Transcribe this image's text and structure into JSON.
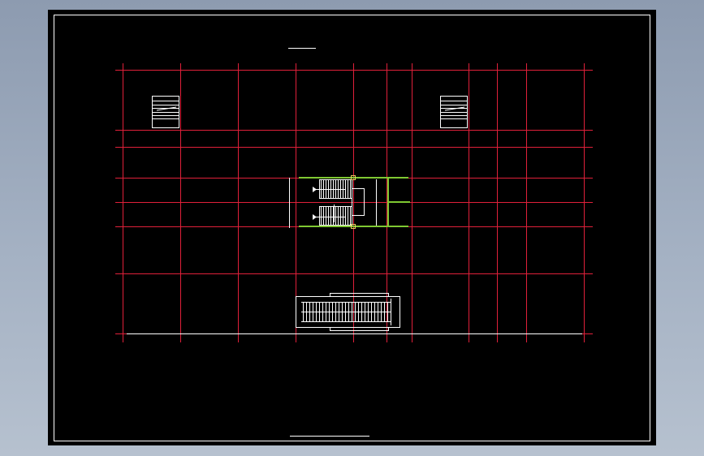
{
  "drawing": {
    "background": "#000000",
    "frame_color": "#ffffff",
    "grid_color": "#e0203a",
    "geometry_color": "#ffffff",
    "wall_color": "#7fc832",
    "node_color": "#e8d060",
    "grid_columns": 13,
    "grid_rows": 8,
    "elements": [
      "left-stair-symbol",
      "right-stair-symbol",
      "central-stair-core",
      "escalator-pair",
      "title-underline"
    ]
  }
}
